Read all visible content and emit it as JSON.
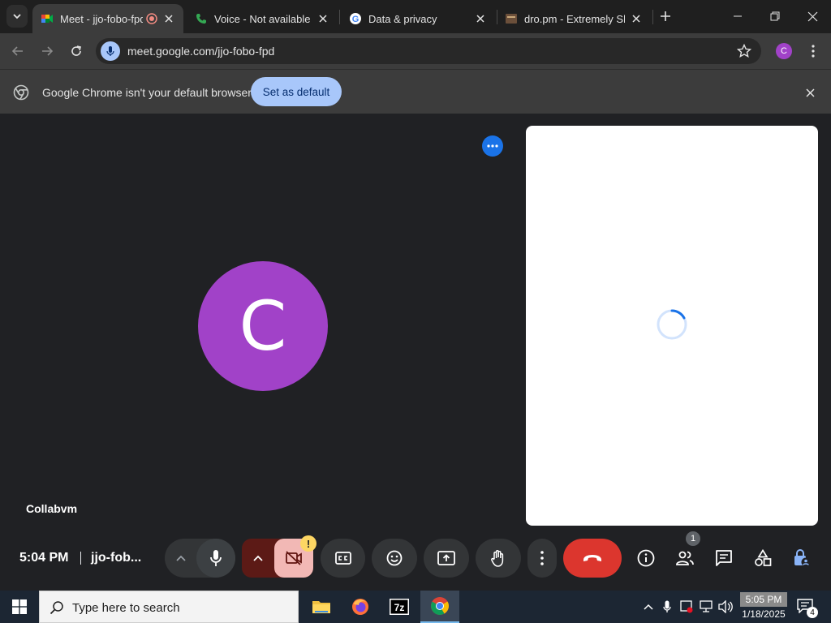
{
  "browser": {
    "tabs": [
      {
        "title": "Meet - jjo-fobo-fpd",
        "active": true,
        "recording": true
      },
      {
        "title": "Voice - Not available",
        "active": false
      },
      {
        "title": "Data & privacy",
        "active": false
      },
      {
        "title": "dro.pm - Extremely Sh",
        "active": false
      }
    ],
    "url": "meet.google.com/jjo-fobo-fpd",
    "profile_initial": "C",
    "infobar": {
      "message": "Google Chrome isn't your default browser",
      "button_label": "Set as default"
    }
  },
  "meet": {
    "participant_initial": "C",
    "participant_name": "Collabvm",
    "time": "5:04 PM",
    "meeting_code": "jjo-fob...",
    "warning_symbol": "!",
    "people_count": "1",
    "colors": {
      "avatar": "#a142c8",
      "end_call": "#dc362e",
      "camera_off": "#f2b8b5",
      "accent": "#1a73e8"
    }
  },
  "taskbar": {
    "search_placeholder": "Type here to search",
    "time": "5:05 PM",
    "date": "1/18/2025",
    "notification_count": "4"
  }
}
